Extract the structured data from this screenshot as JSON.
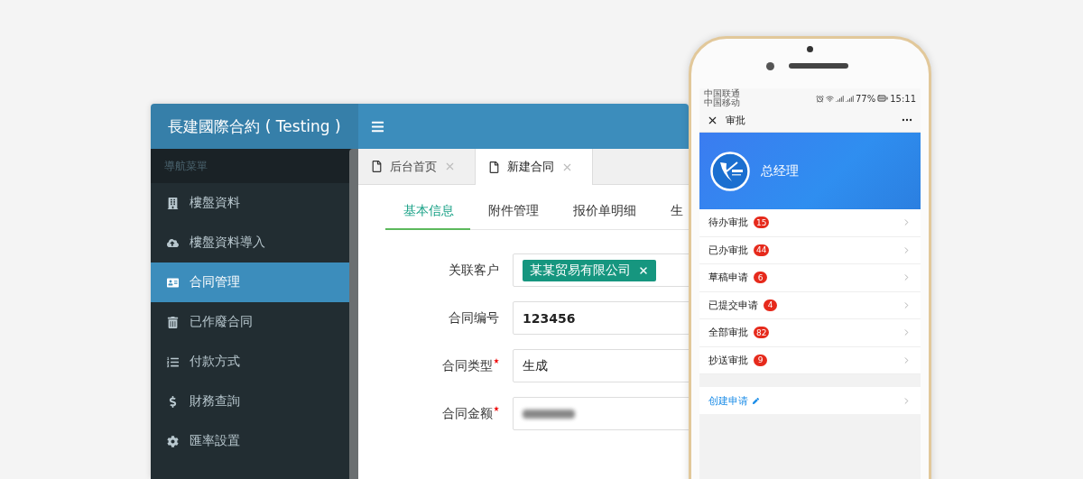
{
  "admin": {
    "title": "長建國際合約 ( Testing )",
    "nav_header": "導航菜單",
    "nav_items": [
      {
        "label": "樓盤資料",
        "selected": false
      },
      {
        "label": "樓盤資料導入",
        "selected": false
      },
      {
        "label": "合同管理",
        "selected": true
      },
      {
        "label": "已作廢合同",
        "selected": false
      },
      {
        "label": "付款方式",
        "selected": false
      },
      {
        "label": "財務查詢",
        "selected": false
      },
      {
        "label": "匯率設置",
        "selected": false
      }
    ],
    "page_tabs": [
      {
        "label": "后台首页",
        "selected": false
      },
      {
        "label": "新建合同",
        "selected": true
      }
    ],
    "form_tabs": [
      {
        "label": "基本信息",
        "selected": true
      },
      {
        "label": "附件管理",
        "selected": false
      },
      {
        "label": "报价单明细",
        "selected": false
      },
      {
        "label": "生",
        "selected": false
      }
    ],
    "fields": [
      {
        "label": "关联客户",
        "kind": "tag",
        "required": false,
        "value": "某某贸易有限公司"
      },
      {
        "label": "合同编号",
        "kind": "text",
        "required": false,
        "value": "123456"
      },
      {
        "label": "合同类型",
        "kind": "text",
        "required": true,
        "value": "生成"
      },
      {
        "label": "合同金额",
        "kind": "blurred",
        "required": true
      }
    ]
  },
  "phone": {
    "carriers": [
      "中国联通",
      "中国移动"
    ],
    "battery": "77%",
    "time": "15:11",
    "title": "审批",
    "banner_name": "总经理",
    "items": [
      {
        "label": "待办审批",
        "count": "15"
      },
      {
        "label": "已办审批",
        "count": "44"
      },
      {
        "label": "草稿申请",
        "count": "6"
      },
      {
        "label": "已提交申请",
        "count": "4"
      },
      {
        "label": "全部审批",
        "count": "82"
      },
      {
        "label": "抄送审批",
        "count": "9"
      }
    ],
    "create": "创建申请"
  }
}
